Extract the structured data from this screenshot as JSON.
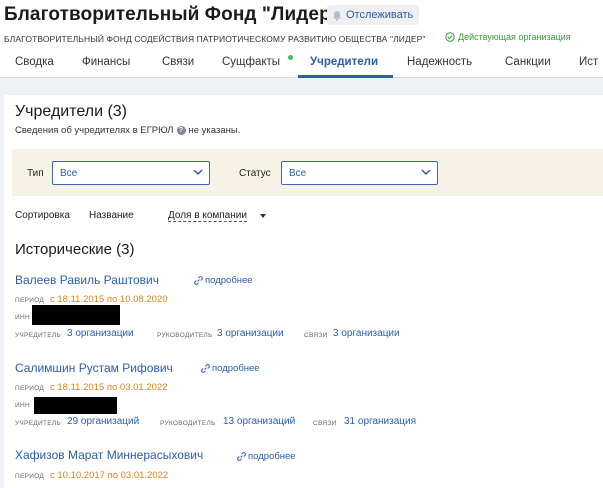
{
  "header": {
    "title": "Благотворительный Фонд \"Лидер\"",
    "watch_label": "Отслеживать",
    "full_name": "БЛАГОТВОРИТЕЛЬНЫЙ ФОНД СОДЕЙСТВИЯ ПАТРИОТИЧЕСКОМУ РАЗВИТИЮ ОБЩЕСТВА \"ЛИДЕР\"",
    "status": "Действующая организация",
    "status_color": "#3d9a3d"
  },
  "tabs": [
    {
      "label": "Сводка"
    },
    {
      "label": "Финансы"
    },
    {
      "label": "Связи"
    },
    {
      "label": "Сущфакты"
    },
    {
      "label": "Учредители",
      "active": true
    },
    {
      "label": "Надежность"
    },
    {
      "label": "Санкции"
    },
    {
      "label": "Ист"
    }
  ],
  "founders": {
    "title": "Учредители (3)",
    "note_prefix": "Сведения об учредителях в ЕГРЮЛ",
    "note_suffix": "не указаны."
  },
  "filters": {
    "type_label": "Тип",
    "type_value": "Все",
    "status_label": "Статус",
    "status_value": "Все"
  },
  "sort": {
    "label": "Сортировка",
    "option_name": "Название",
    "option_share": "Доля в компании"
  },
  "historical": {
    "title": "Исторические (3)",
    "period_label": "ПЕРИОД",
    "inn_label": "ИНН",
    "founder_label": "УЧРЕДИТЕЛЬ",
    "head_label": "РУКОВОДИТЕЛЬ",
    "links_label": "СВЯЗИ",
    "more_label": "подробнее",
    "persons": [
      {
        "name": "Валеев Равиль Раштович",
        "period": "с 18.11.2015 по 10.08.2020",
        "founder": "3 организации",
        "head": "3 организации",
        "links": "3 организации"
      },
      {
        "name": "Салимшин Рустам Рифович",
        "period": "с 18.11.2015 по 03.01.2022",
        "founder": "29 организаций",
        "head": "13 организаций",
        "links": "31 организация"
      },
      {
        "name": "Хафизов Марат Миннерасыхович",
        "period": "с 10.10.2017 по 03.01.2022"
      }
    ]
  },
  "colors": {
    "accent": "#2a5db0",
    "period": "#d9801e",
    "filter_bg": "#f6f3e6",
    "active_dot": "#3cc15a"
  }
}
